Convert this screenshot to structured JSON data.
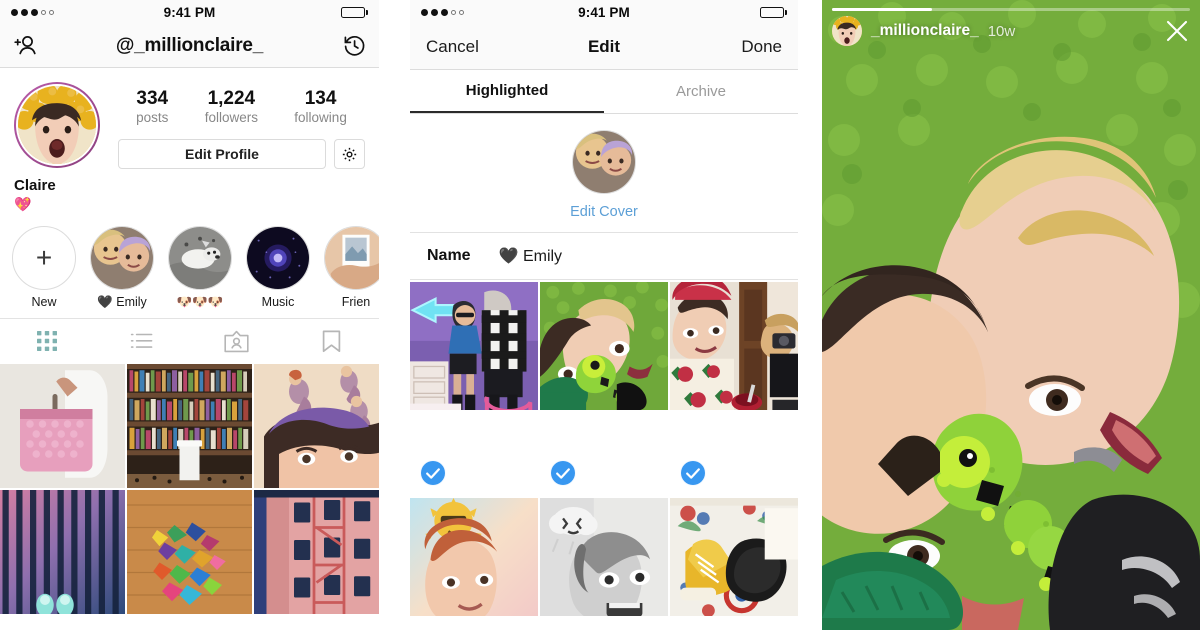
{
  "meta": {
    "accent_blue": "#3897f0",
    "link_blue": "#5c9fd6",
    "muted": "#8e8e8e"
  },
  "profile_panel": {
    "status_bar": {
      "time": "9:41 PM",
      "signal_dots_filled": 3,
      "signal_dots_total": 5
    },
    "nav": {
      "title": "@_millionclaire_",
      "left_icon": "add-person-icon",
      "right_icon": "history-clock-icon"
    },
    "stats": [
      {
        "num": "334",
        "label": "posts"
      },
      {
        "num": "1,224",
        "label": "followers"
      },
      {
        "num": "134",
        "label": "following"
      }
    ],
    "edit_profile_label": "Edit Profile",
    "settings_icon": "gear-icon",
    "bio": {
      "name": "Claire",
      "emoji": "💖"
    },
    "highlights": [
      {
        "label": "New",
        "type": "new"
      },
      {
        "label": "🖤 Emily",
        "type": "cover"
      },
      {
        "label": "🐶🐶🐶",
        "type": "cover"
      },
      {
        "label": "Music",
        "type": "cover"
      },
      {
        "label": "Frien",
        "type": "cover"
      }
    ],
    "tabs": [
      {
        "icon": "grid-icon",
        "active": true
      },
      {
        "icon": "list-icon",
        "active": false
      },
      {
        "icon": "tagged-person-icon",
        "active": false
      },
      {
        "icon": "bookmark-icon",
        "active": false
      }
    ],
    "posts": [
      {
        "alt": "pink-beaded-handbag"
      },
      {
        "alt": "bookshelf-wall"
      },
      {
        "alt": "mermaid-wall-figures"
      },
      {
        "alt": "striped-floor-sneakers"
      },
      {
        "alt": "origami-cranes"
      },
      {
        "alt": "pink-building-fire-escape"
      }
    ]
  },
  "edit_panel": {
    "status_bar": {
      "time": "9:41 PM",
      "signal_dots_filled": 3,
      "signal_dots_total": 5
    },
    "nav": {
      "cancel": "Cancel",
      "title": "Edit",
      "done": "Done"
    },
    "tabs": [
      {
        "label": "Highlighted",
        "active": true
      },
      {
        "label": "Archive",
        "active": false
      }
    ],
    "cover": {
      "edit_label": "Edit Cover"
    },
    "name_row": {
      "key": "Name",
      "value": "🖤 Emily"
    },
    "selection_grid": [
      {
        "alt": "neon-arrow-party",
        "selected": true
      },
      {
        "alt": "grass-caterpillar-selfie",
        "selected": true
      },
      {
        "alt": "red-beret-mirror",
        "selected": true
      },
      {
        "alt": "sun-emoji-filter-selfie",
        "selected": false
      },
      {
        "alt": "rain-cloud-filter-bw",
        "selected": false
      },
      {
        "alt": "yellow-sneakers-feet",
        "selected": false
      }
    ],
    "check_icon": "checkmark-icon"
  },
  "story_panel": {
    "progress_percent": 28,
    "username": "_millionclaire_",
    "timestamp": "10w",
    "close_icon": "close-icon",
    "avatar_alt": "claire-lemons-avatar",
    "image_alt": "two-people-lying-on-green-grass-with-toy-caterpillar"
  }
}
